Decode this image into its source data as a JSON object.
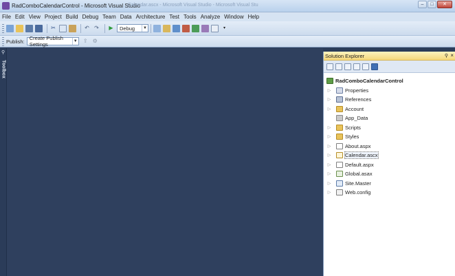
{
  "window": {
    "title": "RadComboCalendarControl - Microsoft Visual Studio",
    "ghost_title": "Calendar.ascx - Microsoft Visual Studio - Microsoft Visual Stu",
    "buttons": {
      "minimize": "–",
      "maximize": "□",
      "close": "✕"
    }
  },
  "menu": [
    "File",
    "Edit",
    "View",
    "Project",
    "Build",
    "Debug",
    "Team",
    "Data",
    "Architecture",
    "Test",
    "Tools",
    "Analyze",
    "Window",
    "Help"
  ],
  "toolbar": {
    "configuration": "Debug",
    "publish_label": "Publish:",
    "publish_profile": "Create Publish Settings"
  },
  "toolbox": {
    "label": "Toolbox"
  },
  "solution_explorer": {
    "title": "Solution Explorer",
    "root": "RadComboCalendarControl",
    "items": [
      {
        "label": "Properties",
        "icon": "properties-icon",
        "expandable": true
      },
      {
        "label": "References",
        "icon": "references-icon",
        "expandable": true
      },
      {
        "label": "Account",
        "icon": "folder-icon",
        "expandable": true
      },
      {
        "label": "App_Data",
        "icon": "special-folder-icon",
        "expandable": false
      },
      {
        "label": "Scripts",
        "icon": "folder-icon",
        "expandable": true
      },
      {
        "label": "Styles",
        "icon": "folder-icon",
        "expandable": true
      },
      {
        "label": "About.aspx",
        "icon": "aspx-file-icon",
        "expandable": true
      },
      {
        "label": "Calendar.ascx",
        "icon": "ascx-file-icon",
        "expandable": true,
        "selected": true
      },
      {
        "label": "Default.aspx",
        "icon": "aspx-file-icon",
        "expandable": true
      },
      {
        "label": "Global.asax",
        "icon": "asax-file-icon",
        "expandable": true
      },
      {
        "label": "Site.Master",
        "icon": "master-file-icon",
        "expandable": true
      },
      {
        "label": "Web.config",
        "icon": "config-file-icon",
        "expandable": true
      }
    ]
  },
  "colors": {
    "editor_bg": "#2f405e",
    "header_bg": "#f5d77a",
    "chrome_bg": "#d6e3f2"
  }
}
